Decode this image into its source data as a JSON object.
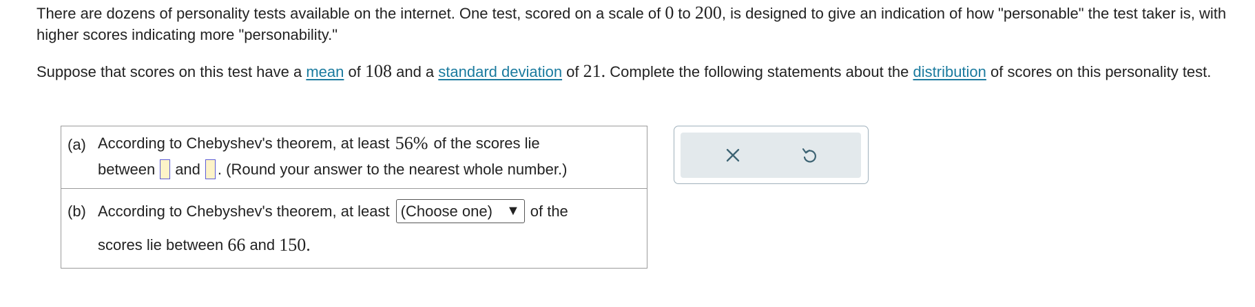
{
  "intro": {
    "p1_a": "There are dozens of personality tests available on the internet. One test, scored on a scale of ",
    "p1_min": "0",
    "p1_b": " to ",
    "p1_max": "200",
    "p1_c": ", is designed to give an indication of how \"personable\" the test taker is, with higher scores indicating more \"personability.\"",
    "p2_a": "Suppose that scores on this test have a ",
    "p2_mean_link": "mean",
    "p2_b": " of ",
    "p2_mean_val": "108",
    "p2_c": " and a ",
    "p2_sd_link": "standard deviation",
    "p2_d": " of ",
    "p2_sd_val": "21.",
    "p2_e": " Complete the following statements about the ",
    "p2_dist_link": "distribution",
    "p2_f": " of scores on this personality test."
  },
  "part_a": {
    "label": "(a)",
    "text1": "According to Chebyshev's theorem, at least ",
    "percent": "56%",
    "text2": " of the scores lie",
    "between": "between",
    "and": "and",
    "suffix": ". (Round your answer to the nearest whole number.)",
    "answer1": "",
    "answer2": ""
  },
  "part_b": {
    "label": "(b)",
    "text1": "According to Chebyshev's theorem, at least",
    "select_value": "(Choose one)",
    "text2": "of the",
    "line2_a": "scores lie between ",
    "low": "66",
    "line2_b": " and ",
    "high": "150."
  },
  "toolbar": {
    "clear_icon": "x-icon",
    "undo_icon": "undo-icon",
    "icon_color": "#3d6373"
  }
}
